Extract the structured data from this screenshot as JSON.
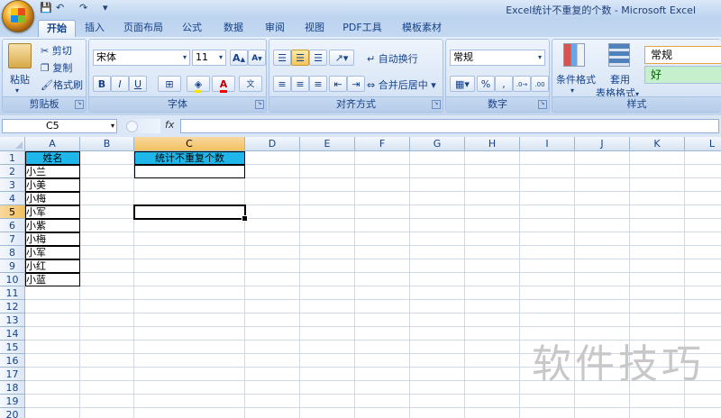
{
  "window": {
    "title": "Excel统计不重复的个数 - Microsoft Excel",
    "quick_access": [
      "💾",
      "↶",
      "↷",
      "▾"
    ]
  },
  "tabs": [
    "开始",
    "插入",
    "页面布局",
    "公式",
    "数据",
    "审阅",
    "视图",
    "PDF工具",
    "模板素材"
  ],
  "ribbon": {
    "clipboard": {
      "label": "剪贴板",
      "paste": "粘贴",
      "cut": "剪切",
      "copy": "复制",
      "format_painter": "格式刷"
    },
    "font": {
      "label": "字体",
      "font_name": "宋体",
      "font_size": "11",
      "bold": "B",
      "italic": "I",
      "underline": "U"
    },
    "alignment": {
      "label": "对齐方式",
      "wrap_text": "自动换行",
      "merge_center": "合并后居中"
    },
    "number": {
      "label": "数字",
      "format": "常规",
      "percent": "%",
      "comma": ","
    },
    "styles": {
      "label": "样式",
      "conditional": "条件格式",
      "table_format_1": "套用",
      "table_format_2": "表格格式",
      "style_normal": "常规",
      "style_good": "好"
    }
  },
  "formula_bar": {
    "name_box": "C5",
    "fx": "fx",
    "formula": ""
  },
  "sheet": {
    "columns": [
      "A",
      "B",
      "C",
      "D",
      "E",
      "F",
      "G",
      "H",
      "I",
      "J",
      "K",
      "L"
    ],
    "rows": [
      "1",
      "2",
      "3",
      "4",
      "5",
      "6",
      "7",
      "8",
      "9",
      "10",
      "11",
      "12",
      "13",
      "14",
      "15",
      "16",
      "17",
      "18",
      "19",
      "20"
    ],
    "selected_cell": "C5",
    "a_header": "姓名",
    "names": [
      "小兰",
      "小美",
      "小梅",
      "小军",
      "小紫",
      "小梅",
      "小军",
      "小红",
      "小蓝"
    ],
    "c_header": "统计不重复个数",
    "c2_value": ""
  },
  "watermark": "软件技巧"
}
